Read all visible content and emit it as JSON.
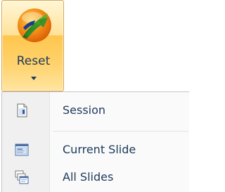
{
  "ribbon": {
    "reset_button": {
      "label": "Reset",
      "icon": "reset-slide-icon",
      "state": "pressed"
    }
  },
  "menu": {
    "items": [
      {
        "label": "Session",
        "icon": "session-page-icon"
      },
      {
        "label": "Current Slide",
        "icon": "current-slide-icon"
      },
      {
        "label": "All Slides",
        "icon": "all-slides-icon"
      }
    ]
  },
  "colors": {
    "button_highlight": "#ffd26c",
    "button_border": "#d8a74f",
    "text": "#1e395b",
    "menu_background": "#fafafa",
    "menu_gutter": "#f0f0f0"
  }
}
